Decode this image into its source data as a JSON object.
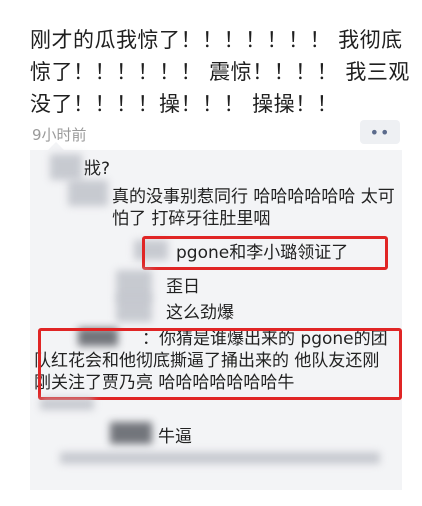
{
  "post": {
    "text": "刚才的瓜我惊了！！！！！！！ 我彻底惊了！！！！！！ 震惊！！！！ 我三观没了！！！！操！！！ 操操！！",
    "time": "9小时前",
    "more_label": "••"
  },
  "comments": [
    {
      "text": "戕?"
    },
    {
      "text": "真的没事别惹同行 哈哈哈哈哈哈 太可怕了 打碎牙往肚里咽"
    },
    {
      "text": "pgone和李小璐领证了"
    },
    {
      "text": "歪日"
    },
    {
      "text": "这么劲爆"
    },
    {
      "text": "：你猜是谁爆出来的 pgone的团队红花会和他彻底撕逼了捅出来的 他队友还刚刚关注了贾乃亮 哈哈哈哈哈哈哈牛"
    },
    {
      "text": "牛逼"
    }
  ],
  "colors": {
    "highlight_box": "#e02525",
    "comment_bg": "#f3f4f6"
  }
}
